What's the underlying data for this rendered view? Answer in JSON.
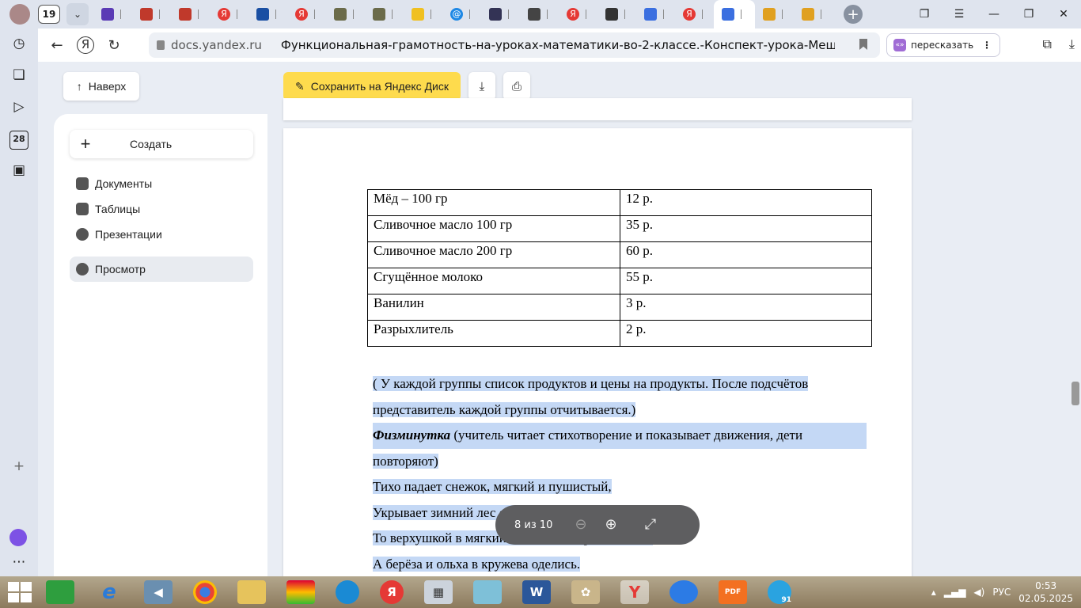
{
  "tabs": {
    "count": "19",
    "items": [
      {
        "name": "tab-1",
        "color": "#5b3bb5"
      },
      {
        "name": "tab-2",
        "color": "#c0392b"
      },
      {
        "name": "tab-3",
        "color": "#c0392b"
      },
      {
        "name": "tab-4",
        "color": "#e53935",
        "glyph": "Я"
      },
      {
        "name": "tab-5",
        "color": "#1a4fa3"
      },
      {
        "name": "tab-6",
        "color": "#e53935",
        "glyph": "Я"
      },
      {
        "name": "tab-7",
        "color": "#6b6b4a"
      },
      {
        "name": "tab-8",
        "color": "#6b6b4a"
      },
      {
        "name": "tab-9",
        "color": "#f0c020"
      },
      {
        "name": "tab-10",
        "color": "#1e88e5",
        "glyph": "@"
      },
      {
        "name": "tab-11",
        "color": "#335"
      },
      {
        "name": "tab-12",
        "color": "#444"
      },
      {
        "name": "tab-13",
        "color": "#e53935",
        "glyph": "Я"
      },
      {
        "name": "tab-14",
        "color": "#333"
      },
      {
        "name": "tab-15",
        "color": "#3b6fe0"
      },
      {
        "name": "tab-16",
        "color": "#e53935",
        "glyph": "Я"
      },
      {
        "name": "tab-17-active",
        "color": "#3b6fe0"
      },
      {
        "name": "tab-18",
        "color": "#e0a020"
      },
      {
        "name": "tab-19",
        "color": "#e0a020"
      }
    ]
  },
  "address": {
    "domain": "docs.yandex.ru",
    "title": "Функциональная-грамотность-на-уроках-математики-во-2-классе.-Конспект-урока-Меш...",
    "retell_label": "пересказать"
  },
  "toolbar": {
    "up_label": "Наверх",
    "save_label": "Сохранить на Яндекс Диск"
  },
  "sidebar": {
    "create_label": "Создать",
    "items": [
      {
        "label": "Документы"
      },
      {
        "label": "Таблицы"
      },
      {
        "label": "Презентации"
      },
      {
        "label": "Просмотр"
      }
    ]
  },
  "document": {
    "table": [
      [
        "Мёд – 100 гр",
        "12 р."
      ],
      [
        "Сливочное масло 100 гр",
        "35 р."
      ],
      [
        "Сливочное масло 200 гр",
        "60 р."
      ],
      [
        "Сгущённое молоко",
        "55 р."
      ],
      [
        "Ванилин",
        "3 р."
      ],
      [
        "Разрыхлитель",
        "2 р."
      ]
    ],
    "para1_line1": "( У каждой группы  список продуктов и цены на продукты. После подсчётов",
    "para1_line2": "представитель каждой группы отчитывается.)",
    "fiz_title": "Физминутка",
    "fiz_rest": " (учитель читает стихотворение и показывает движения, дети",
    "fiz_line2": "повторяют)",
    "poem": [
      "Тихо падает снежок, мягкий и пушистый,",
      "Укрывает зимний лес снегом серебристым.",
      "То верхушкой в мягкий снег клёны провалились,",
      "А берёза и ольха в кружева оделись."
    ]
  },
  "viewer": {
    "page_indicator": "8 из 10"
  },
  "taskbar": {
    "lang": "РУС",
    "time": "0:53",
    "date": "02.05.2025",
    "pdf_badge": "PDF",
    "tg_badge": "91"
  }
}
